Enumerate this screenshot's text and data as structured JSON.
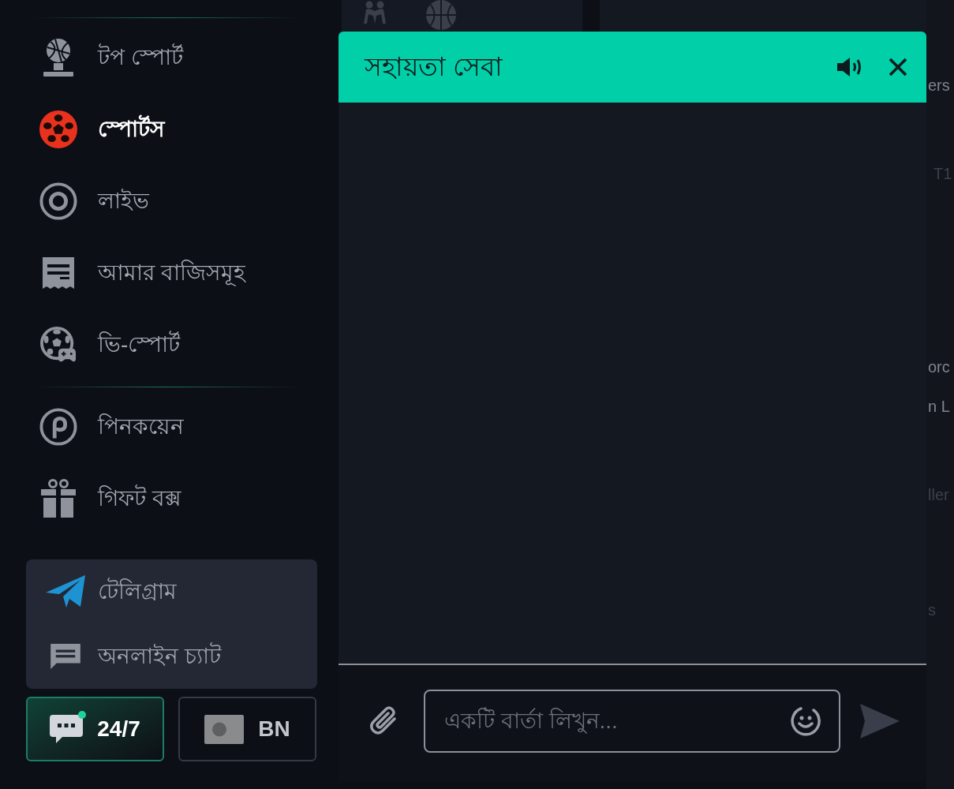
{
  "sidebar": {
    "groups": [
      {
        "items": [
          {
            "label": "টপ স্পোর্ট",
            "selected": false
          },
          {
            "label": "স্পোর্টস",
            "selected": true
          },
          {
            "label": "লাইভ",
            "selected": false
          },
          {
            "label": "আমার বাজিসমূহ",
            "selected": false
          },
          {
            "label": "ভি-স্পোর্ট",
            "selected": false
          }
        ]
      },
      {
        "items": [
          {
            "label": "পিনকয়েন",
            "selected": false
          },
          {
            "label": "গিফট বক্স",
            "selected": false
          }
        ]
      }
    ],
    "contacts": [
      {
        "kind": "telegram",
        "label": "টেলিগ্রাম"
      },
      {
        "kind": "chat",
        "label": "অনলাইন চ্যাট"
      }
    ],
    "footer_buttons": [
      {
        "kind": "support",
        "label": "24/7",
        "selected": true,
        "online": true
      },
      {
        "kind": "language",
        "label": "BN",
        "selected": false
      }
    ]
  },
  "background": {
    "fragments": [
      {
        "text": "ers",
        "dim": false
      },
      {
        "text": "T1",
        "dim": true
      },
      {
        "text": "orc",
        "dim": false
      },
      {
        "text": "n L",
        "dim": false
      },
      {
        "text": "ller",
        "dim": true
      },
      {
        "text": "s",
        "dim": true
      }
    ]
  },
  "chat_window": {
    "title": "সহায়তা সেবা",
    "message_field": {
      "placeholder": "একটি বার্তা লিখুন..."
    }
  }
}
